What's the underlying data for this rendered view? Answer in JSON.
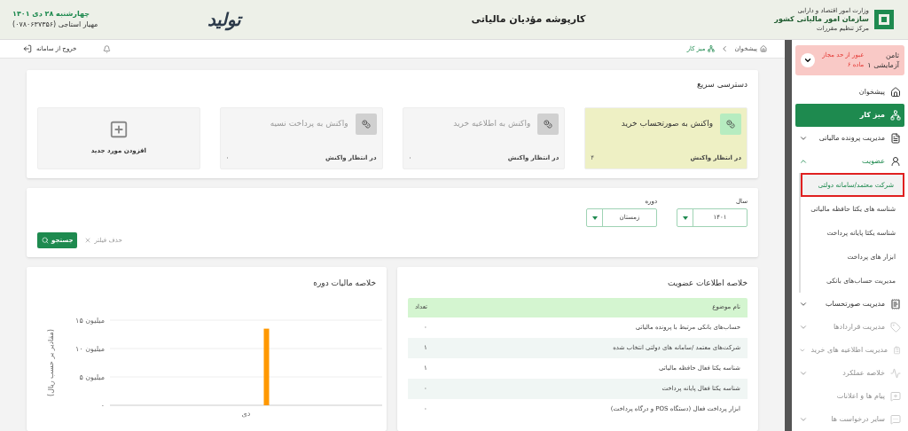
{
  "header": {
    "org_logo_lines": [
      "وزارت امور اقتصاد و دارایی",
      "سازمان امور مالیاتی کشور",
      "مرکز تنظیم مقررات"
    ],
    "title": "کارپوشه مؤدیان مالیاتی",
    "slogan_logo": "تولید",
    "date": "چهارشنبه ۲۸ دی ۱۴۰۱",
    "user": "مهیار استاجی (۰۷۸۰۶۳۷۳۵۶)"
  },
  "breadcrumb": [
    {
      "label": "پیشخوان",
      "kind": "home"
    },
    {
      "label": "میز کار",
      "kind": "current"
    }
  ],
  "toolbar": {
    "logout": "خروج از سامانه"
  },
  "sidebar": {
    "account": {
      "name": "ثامن",
      "subtitle": "آزمایشی ۱",
      "warning": "عبور از حد مجاز",
      "warning_detail": "ماده ۶"
    },
    "items": [
      {
        "label": "پیشخوان",
        "selected": false,
        "disabled": false
      },
      {
        "label": "میز کار",
        "selected": true,
        "disabled": false
      },
      {
        "label": "مدیریت پرونده مالیاتی",
        "selected": false,
        "disabled": false,
        "expanded": false
      },
      {
        "label": "عضویت",
        "selected": false,
        "disabled": false,
        "expanded": true,
        "children": [
          {
            "label": "شرکت معتمد/سامانه دولتی",
            "selected": true
          },
          {
            "label": "شناسه های یکتا حافظه مالیاتی",
            "selected": false
          },
          {
            "label": "شناسه یکتا پایانه پرداخت",
            "selected": false
          },
          {
            "label": "ابزار های پرداخت",
            "selected": false
          },
          {
            "label": "مدیریت حساب‌های بانکی",
            "selected": false
          }
        ]
      },
      {
        "label": "مدیریت صورتحساب",
        "selected": false,
        "disabled": false,
        "expanded": false
      },
      {
        "label": "مدیریت قراردادها",
        "selected": false,
        "disabled": true,
        "expanded": false
      },
      {
        "label": "مدیریت اطلاعیه های خرید",
        "selected": false,
        "disabled": true,
        "expanded": false
      },
      {
        "label": "خلاصه عملکرد",
        "selected": false,
        "disabled": true,
        "expanded": false
      },
      {
        "label": "پیام ها و اعلانات",
        "selected": false,
        "disabled": true
      },
      {
        "label": "سایر درخواست ها",
        "selected": false,
        "disabled": true,
        "expanded": false
      }
    ]
  },
  "quick_access": {
    "title": "دسترسی سریع",
    "cards": [
      {
        "title": "واکنش به صورتحساب خرید",
        "status": "در انتظار واکنش",
        "count": "۴",
        "active": true
      },
      {
        "title": "واکنش به اطلاعیه خرید",
        "status": "در انتظار واکنش",
        "count": "۰",
        "active": false
      },
      {
        "title": "واکنش به پرداخت نسیه",
        "status": "در انتظار واکنش",
        "count": "۰",
        "active": false
      }
    ],
    "add_label": "افزودن مورد جدید"
  },
  "filters": {
    "fields": [
      {
        "label": "سال",
        "value": "۱۴۰۱"
      },
      {
        "label": "دوره",
        "value": "زمستان"
      }
    ],
    "clear": "حذف فیلتر",
    "search": "جستجو"
  },
  "membership": {
    "title": "خلاصه اطلاعات عضویت",
    "columns": [
      "نام موضوع",
      "تعداد"
    ],
    "rows": [
      [
        "حساب‌های بانکی مرتبط با پرونده مالیاتی",
        "۰"
      ],
      [
        "شرکت‌های معتمد /سامانه های دولتی انتخاب شده",
        "۱"
      ],
      [
        "شناسه یکتا فعال حافظه مالیاتی",
        "۱"
      ],
      [
        "شناسه یکتا فعال پایانه پرداخت",
        "۰"
      ],
      [
        "ابزار پرداخت فعال (دستگاه POS و درگاه پرداخت)",
        "۰"
      ]
    ]
  },
  "tax_summary": {
    "chart_data": {
      "type": "bar",
      "title": "خلاصه مالیات دوره",
      "ylabel": "(مقادیر بر حسب ریال)",
      "categories": [
        "دی"
      ],
      "series": [
        {
          "color": "#ff9800",
          "values": [
            13.5
          ]
        }
      ],
      "ylim": [
        0,
        15
      ],
      "yticks": [
        {
          "value": 0,
          "label": "۰"
        },
        {
          "value": 5,
          "label": "۵ میلیون"
        },
        {
          "value": 10,
          "label": "۱۰ میلیون"
        },
        {
          "value": 15,
          "label": "۱۵ میلیون"
        }
      ]
    }
  }
}
